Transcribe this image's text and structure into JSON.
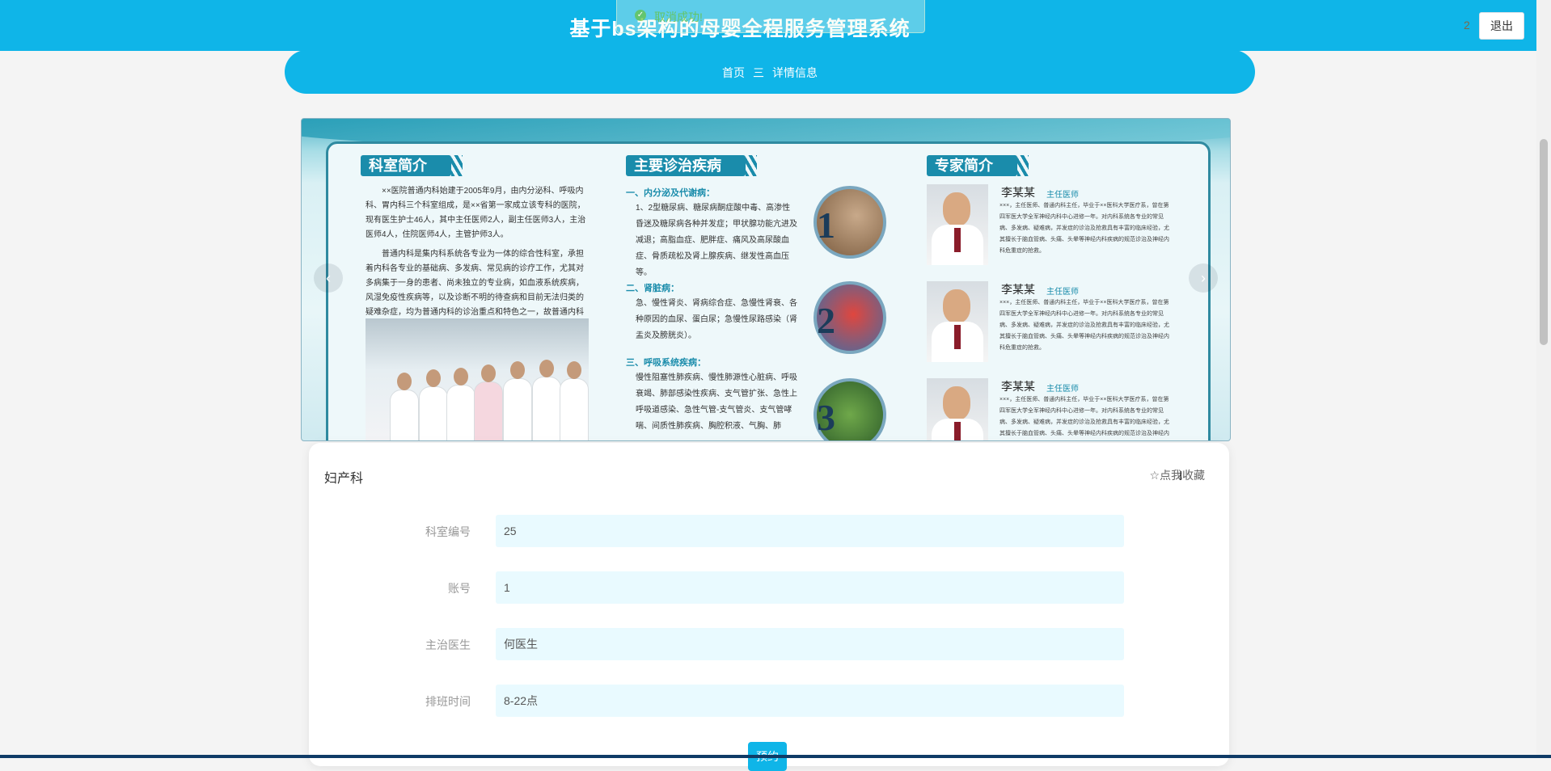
{
  "header": {
    "title": "基于bs架构的母婴全程服务管理系统",
    "user_count": "2",
    "logout_label": "退出"
  },
  "toast": {
    "message": "取消成功!"
  },
  "breadcrumb": {
    "home": "首页",
    "separator": "三",
    "current": "详情信息"
  },
  "banner": {
    "section1_title": "科室简介",
    "section1_para1": "××医院普通内科始建于2005年9月，由内分泌科、呼吸内科、胃内科三个科室组成，是××省第一家成立该专科的医院，现有医生护士46人，其中主任医师2人，副主任医师3人，主治医师4人，住院医师4人，主管护师3人。",
    "section1_para2": "普通内科是集内科系统各专业为一体的综合性科室，承担着内科各专业的基础病、多发病、常见病的诊疗工作，尤其对多病集于一身的患者、尚未独立的专业病，如血液系统疾病，风湿免疫性疾病等，以及诊断不明的待查病和目前无法归类的疑难杂症，均为普通内科的诊治重点和特色之一，故普通内科为临床内科各专业基石。",
    "section2_title": "主要诊治疾病",
    "disease1_title": "一、内分泌及代谢病：",
    "disease1_text": "1、2型糖尿病、糖尿病酮症酸中毒、高渗性昏迷及糖尿病各种并发症；甲状腺功能亢进及减退；高脂血症、肥胖症、痛风及高尿酸血症、骨质疏松及肾上腺疾病、继发性高血压等。",
    "disease2_title": "二、肾脏病：",
    "disease2_text": "急、慢性肾炎、肾病综合症、急慢性肾衰、各种原因的血尿、蛋白尿；急慢性尿路感染（肾盂炎及膀胱炎）。",
    "disease3_title": "三、呼吸系统疾病：",
    "disease3_text": "慢性阻塞性肺疾病、慢性肺源性心脏病、呼吸衰竭、肺部感染性疾病、支气管扩张、急性上呼吸道感染、急性气管-支气管炎、支气管哮喘、间质性肺疾病、胸腔积液、气胸、肺",
    "num1": "1",
    "num2": "2",
    "num3": "3",
    "section3_title": "专家简介",
    "expert_name": "李某某",
    "expert_title": "主任医师",
    "expert_text": "×××，主任医师、普通内科主任，毕业于××医科大学医疗系，曾在第四军医大学全军神经内科中心进修一年。对内科系统各专业的常见病、多发病、疑难病，并发症的诊治及抢救具有丰富的临床经验，尤其擅长于脑血管病、头痛、头晕等神经内科疾病的规范诊治及神经内科危重症的抢救。"
  },
  "carousel_nav": {
    "prev": "‹",
    "next": "›"
  },
  "detail": {
    "department_name": "妇产科",
    "favorite_label": "☆点我收藏",
    "fields": [
      {
        "label": "科室编号",
        "value": "25"
      },
      {
        "label": "账号",
        "value": "1"
      },
      {
        "label": "主治医生",
        "value": "何医生"
      },
      {
        "label": "排班时间",
        "value": "8-22点"
      }
    ],
    "submit_label": "预约"
  },
  "colors": {
    "primary": "#0fb5e8",
    "input_bg": "#e9faff",
    "success": "#67c23a"
  }
}
